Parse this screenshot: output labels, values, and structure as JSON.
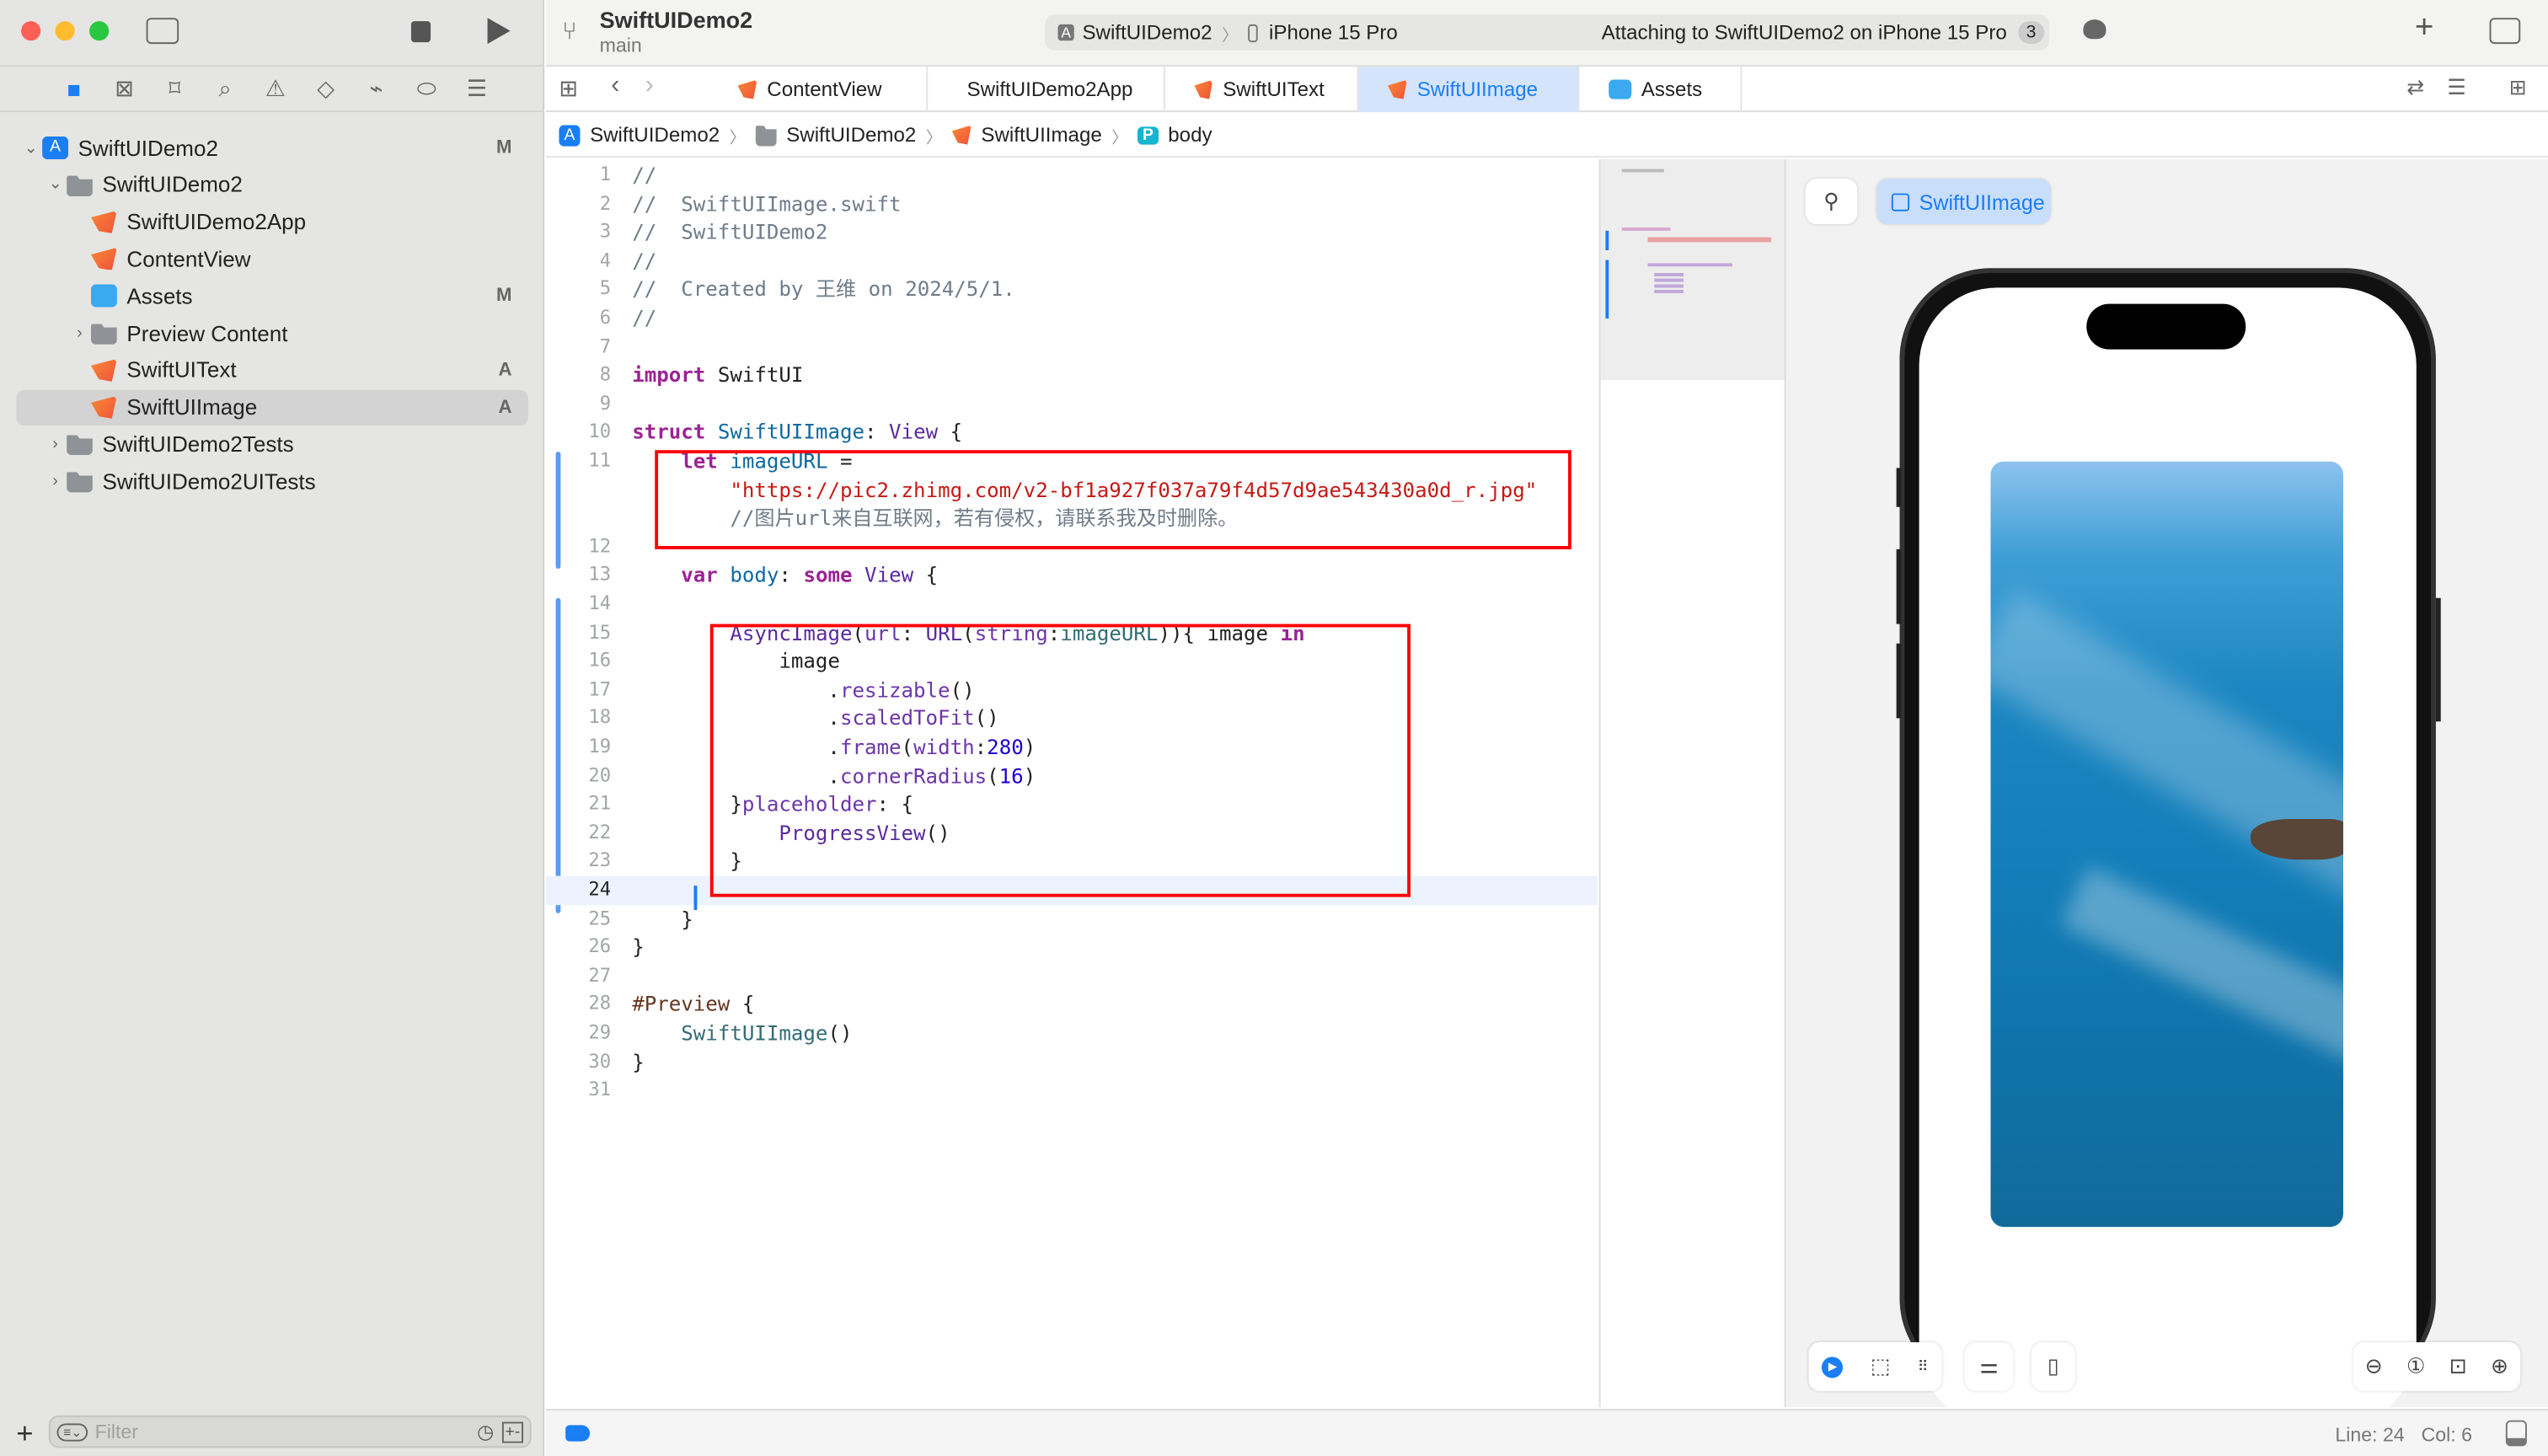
{
  "window": {
    "project": "SwiftUIDemo2",
    "branch": "main"
  },
  "toolbar": {
    "scheme": "SwiftUIDemo2",
    "device": "iPhone 15 Pro",
    "status": "Attaching to SwiftUIDemo2 on iPhone 15 Pro",
    "status_count": "3"
  },
  "sidebar": {
    "nav_icons": [
      "folder-icon",
      "source-control-icon",
      "bookmark-icon",
      "search-icon",
      "warning-icon",
      "test-icon",
      "debug-icon",
      "breakpoint-icon",
      "report-icon"
    ],
    "items": [
      {
        "label": "SwiftUIDemo2",
        "icon": "app",
        "badge": "M",
        "level": 0,
        "chev": "v"
      },
      {
        "label": "SwiftUIDemo2",
        "icon": "folder",
        "badge": "",
        "level": 1,
        "chev": "v"
      },
      {
        "label": "SwiftUIDemo2App",
        "icon": "swift",
        "badge": "",
        "level": 2,
        "chev": ""
      },
      {
        "label": "ContentView",
        "icon": "swift",
        "badge": "",
        "level": 2,
        "chev": ""
      },
      {
        "label": "Assets",
        "icon": "assets",
        "badge": "M",
        "level": 2,
        "chev": ""
      },
      {
        "label": "Preview Content",
        "icon": "folder",
        "badge": "",
        "level": 2,
        "chev": ">"
      },
      {
        "label": "SwiftUIText",
        "icon": "swift",
        "badge": "A",
        "level": 2,
        "chev": ""
      },
      {
        "label": "SwiftUIImage",
        "icon": "swift",
        "badge": "A",
        "level": 2,
        "chev": "",
        "selected": true
      },
      {
        "label": "SwiftUIDemo2Tests",
        "icon": "folder",
        "badge": "",
        "level": 1,
        "chev": ">"
      },
      {
        "label": "SwiftUIDemo2UITests",
        "icon": "folder",
        "badge": "",
        "level": 1,
        "chev": ">"
      }
    ],
    "filter_placeholder": "Filter"
  },
  "tabs": [
    {
      "label": "ContentView",
      "active": false
    },
    {
      "label": "SwiftUIDemo2App",
      "active": false
    },
    {
      "label": "SwiftUIText",
      "active": false
    },
    {
      "label": "SwiftUIImage",
      "active": true
    },
    {
      "label": "Assets",
      "active": false
    }
  ],
  "breadcrumb": [
    "SwiftUIDemo2",
    "SwiftUIDemo2",
    "SwiftUIImage",
    "body"
  ],
  "code": {
    "rows": [
      {
        "n": "1",
        "t": [
          [
            "cm",
            "//"
          ]
        ]
      },
      {
        "n": "2",
        "t": [
          [
            "cm",
            "//  SwiftUIImage.swift"
          ]
        ]
      },
      {
        "n": "3",
        "t": [
          [
            "cm",
            "//  SwiftUIDemo2"
          ]
        ]
      },
      {
        "n": "4",
        "t": [
          [
            "cm",
            "//"
          ]
        ]
      },
      {
        "n": "5",
        "t": [
          [
            "cm",
            "//  Created by 王维 on 2024/5/1."
          ]
        ]
      },
      {
        "n": "6",
        "t": [
          [
            "cm",
            "//"
          ]
        ]
      },
      {
        "n": "7",
        "t": []
      },
      {
        "n": "8",
        "t": [
          [
            "kw",
            "import"
          ],
          [
            "pl",
            " SwiftUI"
          ]
        ]
      },
      {
        "n": "9",
        "t": []
      },
      {
        "n": "10",
        "t": [
          [
            "kw",
            "struct"
          ],
          [
            "pl",
            " "
          ],
          [
            "pr",
            "SwiftUIImage"
          ],
          [
            "pl",
            ": "
          ],
          [
            "ty",
            "View"
          ],
          [
            "pl",
            " {"
          ]
        ]
      },
      {
        "n": "11",
        "t": [
          [
            "pl",
            "    "
          ],
          [
            "kw",
            "let"
          ],
          [
            "pl",
            " "
          ],
          [
            "pr",
            "imageURL"
          ],
          [
            "pl",
            " ="
          ]
        ]
      },
      {
        "n": "",
        "t": [
          [
            "pl",
            "        "
          ],
          [
            "st",
            "\"https://pic2.zhimg.com/v2-bf1a927f037a79f4d57d9ae543430a0d_r.jpg\""
          ]
        ]
      },
      {
        "n": "",
        "t": [
          [
            "pl",
            "        "
          ],
          [
            "cm",
            "//图片url来自互联网，若有侵权，请联系我及时删除。"
          ]
        ]
      },
      {
        "n": "12",
        "t": []
      },
      {
        "n": "13",
        "t": [
          [
            "pl",
            "    "
          ],
          [
            "kw",
            "var"
          ],
          [
            "pl",
            " "
          ],
          [
            "pr",
            "body"
          ],
          [
            "pl",
            ": "
          ],
          [
            "kw",
            "some"
          ],
          [
            "pl",
            " "
          ],
          [
            "ty",
            "View"
          ],
          [
            "pl",
            " {"
          ]
        ]
      },
      {
        "n": "14",
        "t": []
      },
      {
        "n": "15",
        "t": [
          [
            "pl",
            "        "
          ],
          [
            "ty",
            "AsyncImage"
          ],
          [
            "pl",
            "("
          ],
          [
            "fn",
            "url"
          ],
          [
            "pl",
            ": "
          ],
          [
            "ty",
            "URL"
          ],
          [
            "pl",
            "("
          ],
          [
            "fn",
            "string"
          ],
          [
            "pl",
            ":"
          ],
          [
            "dt",
            "imageURL"
          ],
          [
            "pl",
            ")){ image "
          ],
          [
            "kw",
            "in"
          ]
        ]
      },
      {
        "n": "16",
        "t": [
          [
            "pl",
            "            image"
          ]
        ]
      },
      {
        "n": "17",
        "t": [
          [
            "pl",
            "                ."
          ],
          [
            "fn",
            "resizable"
          ],
          [
            "pl",
            "()"
          ]
        ]
      },
      {
        "n": "18",
        "t": [
          [
            "pl",
            "                ."
          ],
          [
            "fn",
            "scaledToFit"
          ],
          [
            "pl",
            "()"
          ]
        ]
      },
      {
        "n": "19",
        "t": [
          [
            "pl",
            "                ."
          ],
          [
            "fn",
            "frame"
          ],
          [
            "pl",
            "("
          ],
          [
            "fn",
            "width"
          ],
          [
            "pl",
            ":"
          ],
          [
            "nu",
            "280"
          ],
          [
            "pl",
            ")"
          ]
        ]
      },
      {
        "n": "20",
        "t": [
          [
            "pl",
            "                ."
          ],
          [
            "fn",
            "cornerRadius"
          ],
          [
            "pl",
            "("
          ],
          [
            "nu",
            "16"
          ],
          [
            "pl",
            ")"
          ]
        ]
      },
      {
        "n": "21",
        "t": [
          [
            "pl",
            "        }"
          ],
          [
            "fn",
            "placeholder"
          ],
          [
            "pl",
            ": {"
          ]
        ]
      },
      {
        "n": "22",
        "t": [
          [
            "pl",
            "            "
          ],
          [
            "ty",
            "ProgressView"
          ],
          [
            "pl",
            "()"
          ]
        ]
      },
      {
        "n": "23",
        "t": [
          [
            "pl",
            "        }"
          ]
        ]
      },
      {
        "n": "24",
        "t": [],
        "current": true
      },
      {
        "n": "25",
        "t": [
          [
            "pl",
            "    }"
          ]
        ]
      },
      {
        "n": "26",
        "t": [
          [
            "pl",
            "}"
          ]
        ]
      },
      {
        "n": "27",
        "t": []
      },
      {
        "n": "28",
        "t": [
          [
            "md",
            "#Preview"
          ],
          [
            "pl",
            " {"
          ]
        ]
      },
      {
        "n": "29",
        "t": [
          [
            "pl",
            "    "
          ],
          [
            "dt",
            "SwiftUIImage"
          ],
          [
            "pl",
            "()"
          ]
        ]
      },
      {
        "n": "30",
        "t": [
          [
            "pl",
            "}"
          ]
        ]
      },
      {
        "n": "31",
        "t": []
      }
    ]
  },
  "canvas": {
    "preview_label": "SwiftUIImage",
    "device": "iPhone 15 Pro"
  },
  "status": {
    "line": "Line: 24",
    "col": "Col: 6"
  },
  "colors": {
    "accent": "#1a7ef5",
    "highlight_box": "#ff0000"
  }
}
